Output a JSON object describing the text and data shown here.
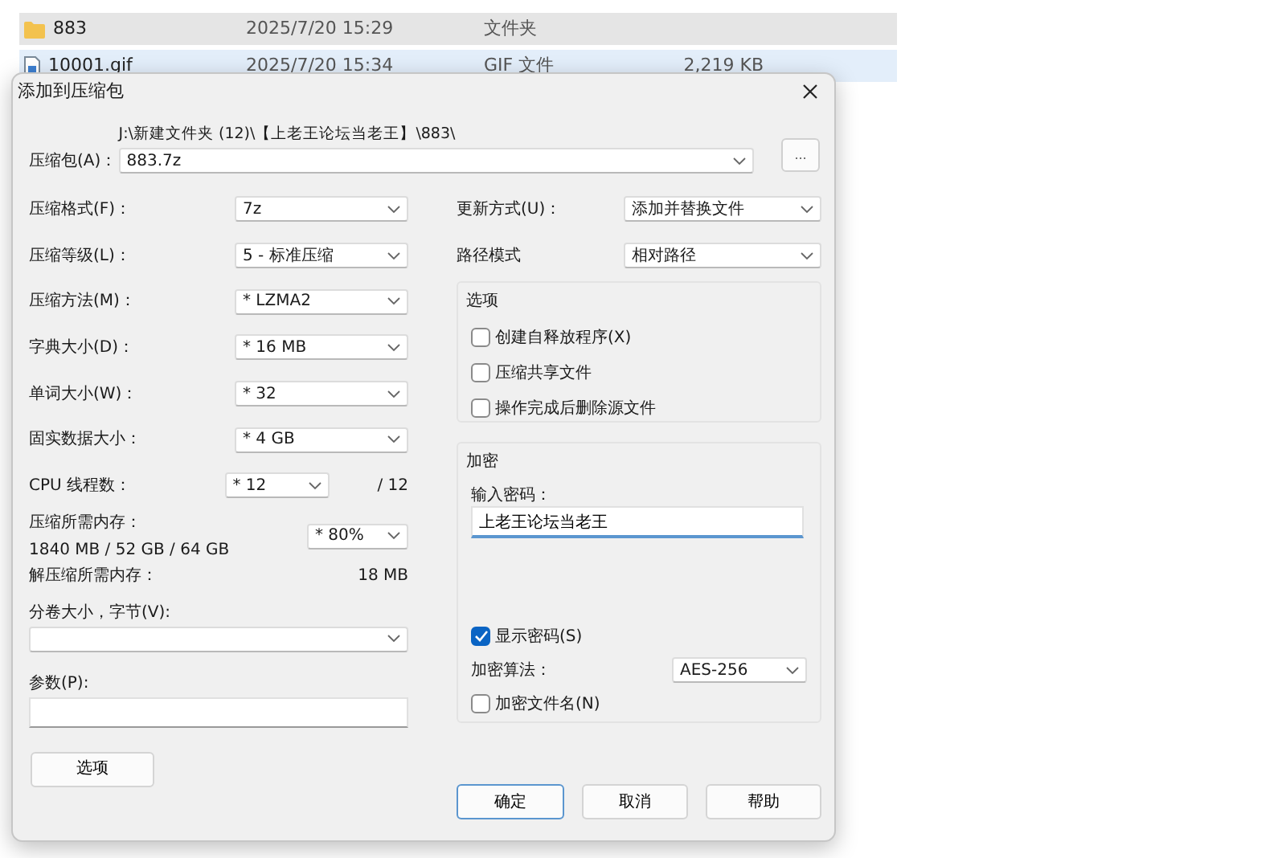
{
  "file_list": {
    "rows": [
      {
        "kind": "folder",
        "name": "883",
        "date": "2025/7/20 15:29",
        "type": "文件夹",
        "selected": true,
        "hovered": false
      },
      {
        "kind": "file",
        "name": "10001.gif",
        "date": "2025/7/20 15:34",
        "type": "GIF 文件",
        "size": "2,219 KB",
        "selected": false,
        "hovered": true
      }
    ]
  },
  "dialog": {
    "title": "添加到压缩包",
    "archive": {
      "label": "压缩包(A)：",
      "path": "J:\\新建文件夹 (12)\\【上老王论坛当老王】\\883\\",
      "value": "883.7z",
      "browse": "..."
    },
    "left_fields": [
      {
        "label": "压缩格式(F)：",
        "value": "7z"
      },
      {
        "label": "压缩等级(L)：",
        "value": "5 - 标准压缩"
      },
      {
        "label": "压缩方法(M)：",
        "value": "* LZMA2"
      },
      {
        "label": "字典大小(D)：",
        "value": "* 16 MB"
      },
      {
        "label": "单词大小(W)：",
        "value": "* 32"
      },
      {
        "label": "固实数据大小：",
        "value": "* 4 GB"
      }
    ],
    "threads": {
      "label": "CPU 线程数：",
      "value": "* 12",
      "max": "/ 12"
    },
    "memory": {
      "label": "压缩所需内存：",
      "detail": "1840 MB / 52 GB / 64 GB",
      "value": "* 80%"
    },
    "decompress_memory": {
      "label": "解压缩所需内存：",
      "value": "18 MB"
    },
    "volume": {
      "label": "分卷大小，字节(V):"
    },
    "parameters": {
      "label": "参数(P):"
    },
    "options_button": "选项",
    "right_fields": [
      {
        "label": "更新方式(U)：",
        "value": "添加并替换文件"
      },
      {
        "label": "路径模式",
        "value": "相对路径"
      }
    ],
    "options_group": {
      "title": "选项",
      "checks": [
        {
          "label": "创建自释放程序(X)",
          "checked": false
        },
        {
          "label": "压缩共享文件",
          "checked": false
        },
        {
          "label": "操作完成后删除源文件",
          "checked": false
        }
      ]
    },
    "encryption": {
      "title": "加密",
      "password_label": "输入密码：",
      "password": "上老王论坛当老王",
      "show_password": {
        "label": "显示密码(S)",
        "checked": true
      },
      "method_label": "加密算法：",
      "method": "AES-256",
      "encrypt_names": {
        "label": "加密文件名(N)",
        "checked": false
      }
    },
    "buttons": [
      {
        "label": "确定",
        "default": true
      },
      {
        "label": "取消",
        "default": false
      },
      {
        "label": "帮助",
        "default": false
      }
    ]
  }
}
